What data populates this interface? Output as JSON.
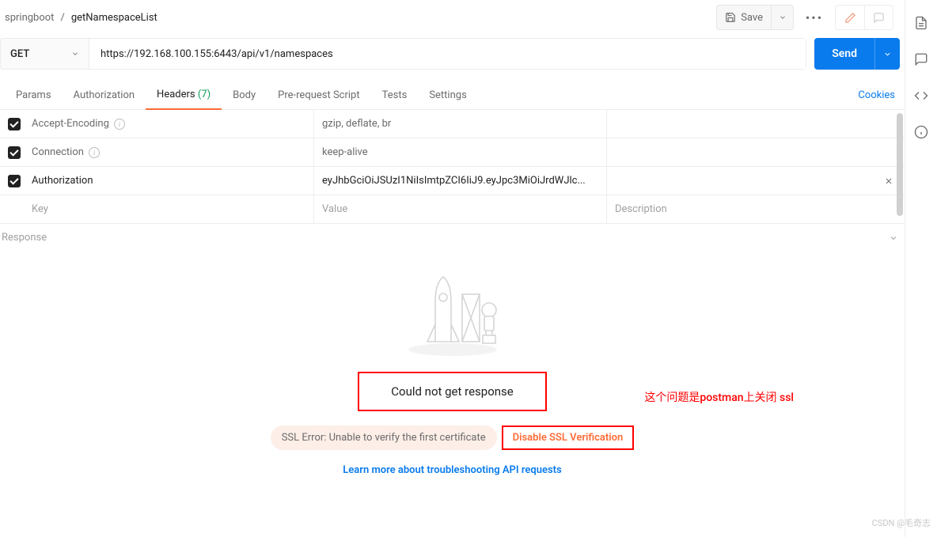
{
  "breadcrumb": {
    "parent": "springboot",
    "sep": "/",
    "current": "getNamespaceList"
  },
  "topbar": {
    "save": "Save"
  },
  "request": {
    "method": "GET",
    "url": "https://192.168.100.155:6443/api/v1/namespaces",
    "send": "Send"
  },
  "tabs": {
    "params": "Params",
    "auth": "Authorization",
    "headers_label": "Headers",
    "headers_count": "(7)",
    "body": "Body",
    "prereq": "Pre-request Script",
    "tests": "Tests",
    "settings": "Settings",
    "cookies": "Cookies"
  },
  "headers": {
    "rows": [
      {
        "key": "Accept-Encoding",
        "value": "gzip, deflate, br",
        "info": true
      },
      {
        "key": "Connection",
        "value": "keep-alive",
        "info": true
      },
      {
        "key": "Authorization",
        "value": "eyJhbGciOiJSUzI1NiIsImtpZCI6IiJ9.eyJpc3MiOiJrdWJlc...",
        "info": false,
        "removable": true
      }
    ],
    "ph_key": "Key",
    "ph_value": "Value",
    "ph_desc": "Description"
  },
  "response": {
    "label": "Response",
    "title": "Could not get response",
    "ssl_error": "SSL Error: Unable to verify the first certificate",
    "disable_ssl": "Disable SSL Verification",
    "learn": "Learn more about troubleshooting API requests",
    "annotation": "这个问题是postman上关闭 ssl"
  },
  "watermark": "CSDN @毛奇志"
}
